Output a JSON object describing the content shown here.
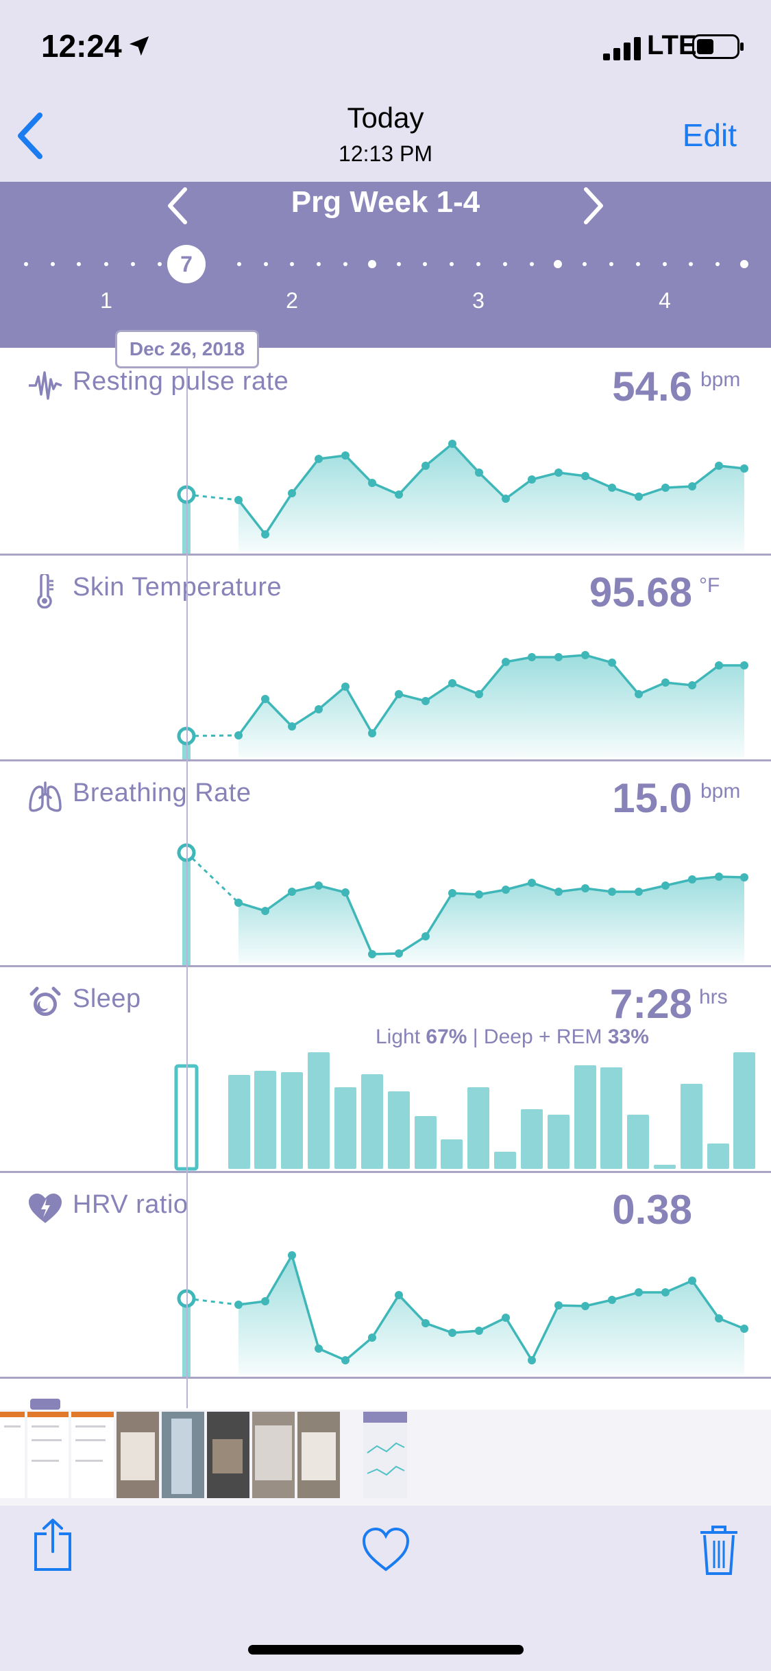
{
  "status": {
    "time": "12:24",
    "carrier": "LTE"
  },
  "nav": {
    "title": "Today",
    "subtitle": "12:13 PM",
    "edit_label": "Edit"
  },
  "week": {
    "title": "Prg Week 1-4",
    "selected_day": "7",
    "week_numbers": [
      "1",
      "2",
      "3",
      "4"
    ]
  },
  "cursor_date": "Dec 26, 2018",
  "panels": {
    "pulse": {
      "label": "Resting pulse rate",
      "value": "54.6",
      "unit": "bpm",
      "icon": "pulse-wave-icon"
    },
    "temp": {
      "label": "Skin Temperature",
      "value": "95.68",
      "unit": "°F",
      "icon": "thermometer-icon"
    },
    "breathing": {
      "label": "Breathing Rate",
      "value": "15.0",
      "unit": "bpm",
      "icon": "lungs-icon"
    },
    "sleep": {
      "label": "Sleep",
      "value": "7:28",
      "unit": "hrs",
      "icon": "alarm-clock-icon",
      "light_label": "Light",
      "light_pct": "67%",
      "deep_label": "| Deep + REM",
      "deep_pct": "33%"
    },
    "hrv": {
      "label": "HRV ratio",
      "value": "0.38",
      "icon": "heart-bolt-icon"
    }
  },
  "colors": {
    "accent": "#1a7cf0",
    "purple_header": "#8b87bb",
    "label_purple": "#8782b8",
    "teal": "#4ec2c4"
  }
}
